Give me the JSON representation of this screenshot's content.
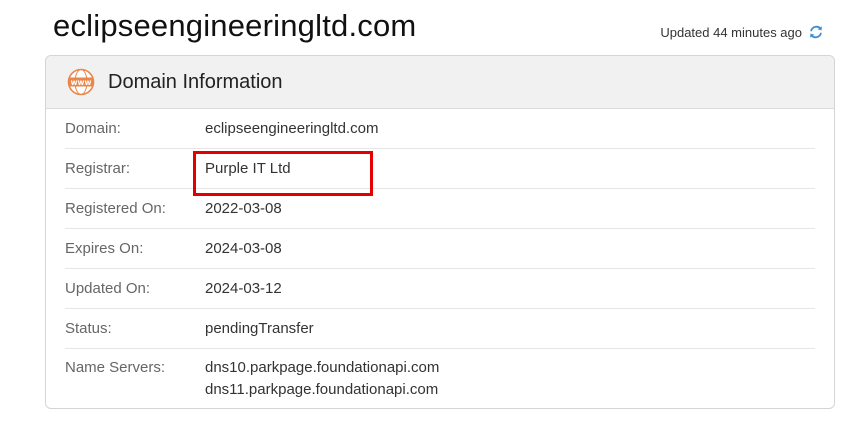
{
  "page": {
    "domain_title": "eclipseengineeringltd.com",
    "updated_text": "Updated 44 minutes ago",
    "refresh_icon": "refresh-icon"
  },
  "card": {
    "icon": "www-icon",
    "icon_text": "www",
    "title": "Domain Information",
    "rows": [
      {
        "label": "Domain:",
        "value": "eclipseengineeringltd.com"
      },
      {
        "label": "Registrar:",
        "value": "Purple IT Ltd"
      },
      {
        "label": "Registered On:",
        "value": "2022-03-08"
      },
      {
        "label": "Expires On:",
        "value": "2024-03-08"
      },
      {
        "label": "Updated On:",
        "value": "2024-03-12"
      },
      {
        "label": "Status:",
        "value": "pendingTransfer"
      }
    ],
    "name_servers": {
      "label": "Name Servers:",
      "values": [
        "dns10.parkpage.foundationapi.com",
        "dns11.parkpage.foundationapi.com"
      ]
    }
  },
  "colors": {
    "accent_orange": "#e8874a",
    "refresh_blue": "#3a8fd8",
    "highlight_red": "#e20000",
    "header_bg": "#f1f1f1"
  }
}
